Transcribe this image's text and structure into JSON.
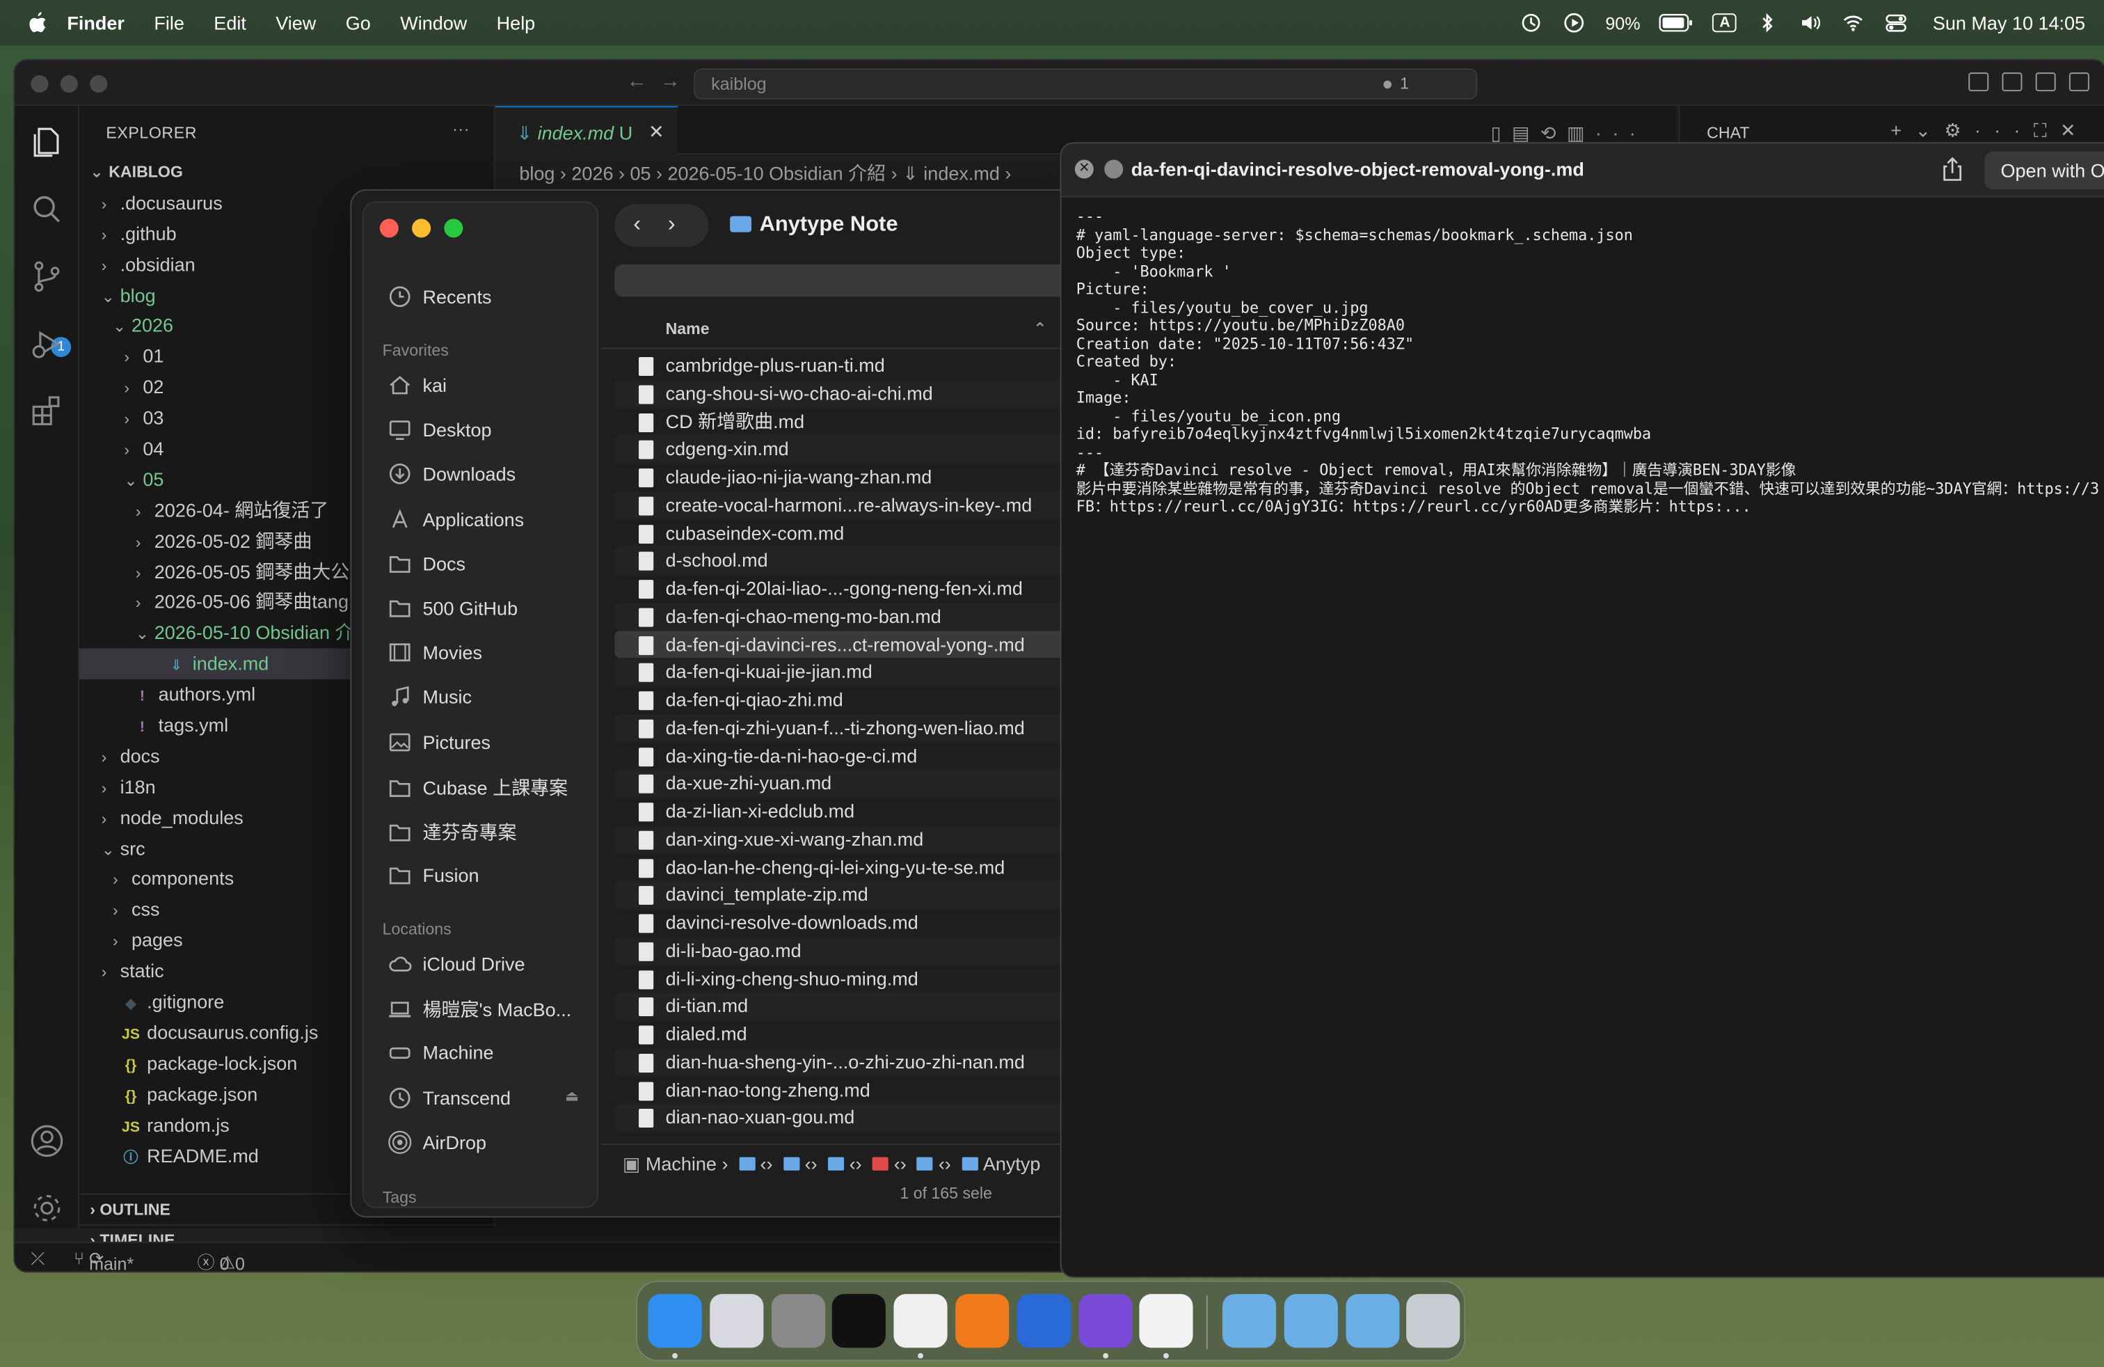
{
  "menubar": {
    "app": "Finder",
    "items": [
      "File",
      "Edit",
      "View",
      "Go",
      "Window",
      "Help"
    ],
    "battery": "90%",
    "input_indicator": "A",
    "datetime": "Sun May 10  14:05"
  },
  "vscode": {
    "search": "kaiblog",
    "search_badge": "1",
    "explorer_title": "EXPLORER",
    "explorer_more": "···",
    "source_control_badge": "1",
    "tree": [
      {
        "label": "KAIBLOG",
        "indent": 0,
        "chev": "⌄",
        "type": "root"
      },
      {
        "label": ".docusaurus",
        "indent": 1,
        "chev": "›",
        "type": "folder"
      },
      {
        "label": ".github",
        "indent": 1,
        "chev": "›",
        "type": "folder"
      },
      {
        "label": ".obsidian",
        "indent": 1,
        "chev": "›",
        "type": "folder"
      },
      {
        "label": "blog",
        "indent": 1,
        "chev": "⌄",
        "type": "folder-green"
      },
      {
        "label": "2026",
        "indent": 2,
        "chev": "⌄",
        "type": "folder-green"
      },
      {
        "label": "01",
        "indent": 3,
        "chev": "›",
        "type": "folder"
      },
      {
        "label": "02",
        "indent": 3,
        "chev": "›",
        "type": "folder"
      },
      {
        "label": "03",
        "indent": 3,
        "chev": "›",
        "type": "folder"
      },
      {
        "label": "04",
        "indent": 3,
        "chev": "›",
        "type": "folder"
      },
      {
        "label": "05",
        "indent": 3,
        "chev": "⌄",
        "type": "folder-green"
      },
      {
        "label": "2026-04- 網站復活了",
        "indent": 4,
        "chev": "›",
        "type": "folder"
      },
      {
        "label": "2026-05-02 鋼琴曲",
        "indent": 4,
        "chev": "›",
        "type": "folder"
      },
      {
        "label": "2026-05-05 鋼琴曲大公",
        "indent": 4,
        "chev": "›",
        "type": "folder"
      },
      {
        "label": "2026-05-06 鋼琴曲tang",
        "indent": 4,
        "chev": "›",
        "type": "folder"
      },
      {
        "label": "2026-05-10 Obsidian 介",
        "indent": 4,
        "chev": "⌄",
        "type": "folder-green"
      },
      {
        "label": "index.md",
        "indent": 5,
        "chev": "",
        "type": "md",
        "icon": "⇓",
        "selected": true
      },
      {
        "label": "authors.yml",
        "indent": 2,
        "chev": "",
        "type": "yml",
        "icon": "!"
      },
      {
        "label": "tags.yml",
        "indent": 2,
        "chev": "",
        "type": "yml",
        "icon": "!"
      },
      {
        "label": "docs",
        "indent": 1,
        "chev": "›",
        "type": "folder"
      },
      {
        "label": "i18n",
        "indent": 1,
        "chev": "›",
        "type": "folder"
      },
      {
        "label": "node_modules",
        "indent": 1,
        "chev": "›",
        "type": "folder"
      },
      {
        "label": "src",
        "indent": 1,
        "chev": "⌄",
        "type": "folder"
      },
      {
        "label": "components",
        "indent": 2,
        "chev": "›",
        "type": "folder"
      },
      {
        "label": "css",
        "indent": 2,
        "chev": "›",
        "type": "folder"
      },
      {
        "label": "pages",
        "indent": 2,
        "chev": "›",
        "type": "folder"
      },
      {
        "label": "static",
        "indent": 1,
        "chev": "›",
        "type": "folder"
      },
      {
        "label": ".gitignore",
        "indent": 1,
        "chev": "",
        "type": "git",
        "icon": "◆"
      },
      {
        "label": "docusaurus.config.js",
        "indent": 1,
        "chev": "",
        "type": "js",
        "icon": "JS"
      },
      {
        "label": "package-lock.json",
        "indent": 1,
        "chev": "",
        "type": "json",
        "icon": "{}"
      },
      {
        "label": "package.json",
        "indent": 1,
        "chev": "",
        "type": "json",
        "icon": "{}"
      },
      {
        "label": "random.js",
        "indent": 1,
        "chev": "",
        "type": "js",
        "icon": "JS"
      },
      {
        "label": "README.md",
        "indent": 1,
        "chev": "",
        "type": "info",
        "icon": "ⓘ"
      }
    ],
    "outline": "OUTLINE",
    "timeline": "TIMELINE",
    "tab_label": "index.md",
    "tab_status": "U",
    "breadcrumb": "blog › 2026 › 05 › 2026-05-10 Obsidian 介紹 › ⇓ index.md ›",
    "chat_title": "CHAT",
    "status_branch": "main*",
    "status_errors": "0",
    "status_warnings": "0"
  },
  "finder": {
    "title": "Anytype Note",
    "sidebar": {
      "recents": "Recents",
      "favorites_label": "Favorites",
      "favorites": [
        {
          "label": "kai",
          "icon": "home-icon"
        },
        {
          "label": "Desktop",
          "icon": "desktop-icon"
        },
        {
          "label": "Downloads",
          "icon": "download-icon"
        },
        {
          "label": "Applications",
          "icon": "applications-icon"
        },
        {
          "label": "Docs",
          "icon": "folder-icon"
        },
        {
          "label": "500 GitHub",
          "icon": "folder-icon"
        },
        {
          "label": "Movies",
          "icon": "film-icon"
        },
        {
          "label": "Music",
          "icon": "music-icon"
        },
        {
          "label": "Pictures",
          "icon": "photo-icon"
        },
        {
          "label": "Cubase 上課專案",
          "icon": "folder-icon"
        },
        {
          "label": "達芬奇專案",
          "icon": "folder-icon"
        },
        {
          "label": "Fusion",
          "icon": "folder-icon"
        }
      ],
      "locations_label": "Locations",
      "locations": [
        {
          "label": "iCloud Drive",
          "icon": "cloud-icon"
        },
        {
          "label": "楊暟宸's MacBo...",
          "icon": "laptop-icon"
        },
        {
          "label": "Machine",
          "icon": "drive-icon"
        },
        {
          "label": "Transcend",
          "icon": "clock-drive-icon"
        },
        {
          "label": "AirDrop",
          "icon": "airdrop-icon"
        }
      ],
      "tags_label": "Tags"
    },
    "column_name": "Name",
    "files": [
      "cambridge-plus-ruan-ti.md",
      "cang-shou-si-wo-chao-ai-chi.md",
      "CD 新增歌曲.md",
      "cdgeng-xin.md",
      "claude-jiao-ni-jia-wang-zhan.md",
      "create-vocal-harmoni...re-always-in-key-.md",
      "cubaseindex-com.md",
      "d-school.md",
      "da-fen-qi-20lai-liao-...-gong-neng-fen-xi.md",
      "da-fen-qi-chao-meng-mo-ban.md",
      "da-fen-qi-davinci-res...ct-removal-yong-.md",
      "da-fen-qi-kuai-jie-jian.md",
      "da-fen-qi-qiao-zhi.md",
      "da-fen-qi-zhi-yuan-f...-ti-zhong-wen-liao.md",
      "da-xing-tie-da-ni-hao-ge-ci.md",
      "da-xue-zhi-yuan.md",
      "da-zi-lian-xi-edclub.md",
      "dan-xing-xue-xi-wang-zhan.md",
      "dao-lan-he-cheng-qi-lei-xing-yu-te-se.md",
      "davinci_template-zip.md",
      "davinci-resolve-downloads.md",
      "di-li-bao-gao.md",
      "di-li-xing-cheng-shuo-ming.md",
      "di-tian.md",
      "dialed.md",
      "dian-hua-sheng-yin-...o-zhi-zuo-zhi-nan.md",
      "dian-nao-tong-zheng.md",
      "dian-nao-xuan-gou.md"
    ],
    "selected_index": 10,
    "path_start": "Machine",
    "path_end": "Anytyp",
    "status": "1 of 165 sele"
  },
  "quicklook": {
    "title": "da-fen-qi-davinci-resolve-object-removal-yong-.md",
    "open_with": "Open with O",
    "content": "---\n# yaml-language-server: $schema=schemas/bookmark_.schema.json\nObject type:\n    - 'Bookmark '\nPicture:\n    - files/youtu_be_cover_u.jpg\nSource: https://youtu.be/MPhiDzZ08A0\nCreation date: \"2025-10-11T07:56:43Z\"\nCreated by:\n    - KAI\nImage:\n    - files/youtu_be_icon.png\nid: bafyreib7o4eqlkyjnx4ztfvg4nmlwjl5ixomen2kt4tzqie7urycaqmwba\n---\n# 【達芬奇Davinci resolve - Object removal，用AI來幫你消除雜物】｜廣告導演BEN-3DAY影像\n影片中要消除某些雜物是常有的事，達芬奇Davinci resolve 的Object removal是一個蠻不錯、快速可以達到效果的功能~3DAY官網：https://3\nFB：https://reurl.cc/0AjgY3IG：https://reurl.cc/yr60AD更多商業影片：https:..."
  },
  "dock": {
    "apps": [
      {
        "name": "finder",
        "color": "#2f8ff0"
      },
      {
        "name": "launchpad",
        "color": "#d8d8e0"
      },
      {
        "name": "system-settings",
        "color": "#8a8a8a"
      },
      {
        "name": "ai-app",
        "color": "#111111"
      },
      {
        "name": "brave",
        "color": "#f0f0f0"
      },
      {
        "name": "pages",
        "color": "#f07a1a"
      },
      {
        "name": "keynote",
        "color": "#2a6ad8"
      },
      {
        "name": "github-desktop",
        "color": "#7a4ad8"
      },
      {
        "name": "vscode",
        "color": "#f2f2f2"
      },
      {
        "name": "applications-folder",
        "color": "#6aaee8"
      },
      {
        "name": "documents-folder",
        "color": "#6aaee8"
      },
      {
        "name": "downloads-folder",
        "color": "#6aaee8"
      },
      {
        "name": "trash",
        "color": "#c8ccd2"
      }
    ]
  }
}
